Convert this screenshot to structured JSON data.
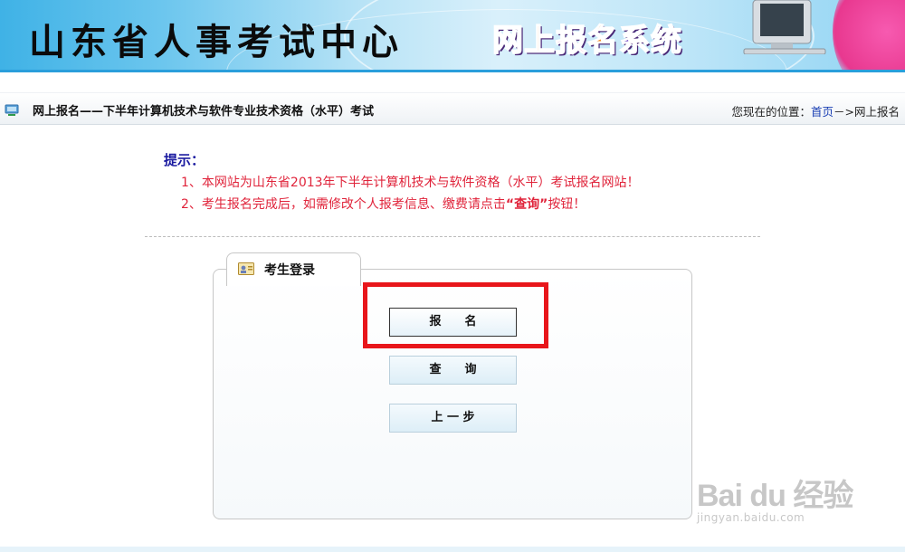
{
  "banner": {
    "org_title": "山东省人事考试中心",
    "system_title_chars": [
      "网",
      "上",
      "报",
      "名",
      "系",
      "统"
    ]
  },
  "location_bar": {
    "page_title": "网上报名——下半年计算机技术与软件专业技术资格（水平）考试",
    "position_label": "您现在的位置：",
    "home_link": "首页",
    "separator": "－>",
    "current": "网上报名"
  },
  "tips": {
    "heading": "提示：",
    "items": [
      "1、本网站为山东省2013年下半年计算机技术与软件资格（水平）考试报名网站！",
      "2、考生报名完成后，如需修改个人报考信息、缴费请点击"
    ],
    "item2_emphasis": "“查询”",
    "item2_tail": "按钮！"
  },
  "login_panel": {
    "tab_label": "考生登录",
    "buttons": {
      "register": "报　　名",
      "query": "查　　询",
      "back": "上 一 步"
    }
  },
  "watermark": {
    "logo": "Bai du 经验",
    "sub": "jingyan.baidu.com"
  },
  "colors": {
    "banner_blue": "#2a9edb",
    "tip_red": "#e0243b",
    "tip_heading_blue": "#1a1aa0",
    "highlight_red": "#e8161b",
    "link_blue": "#1a3fb3"
  }
}
